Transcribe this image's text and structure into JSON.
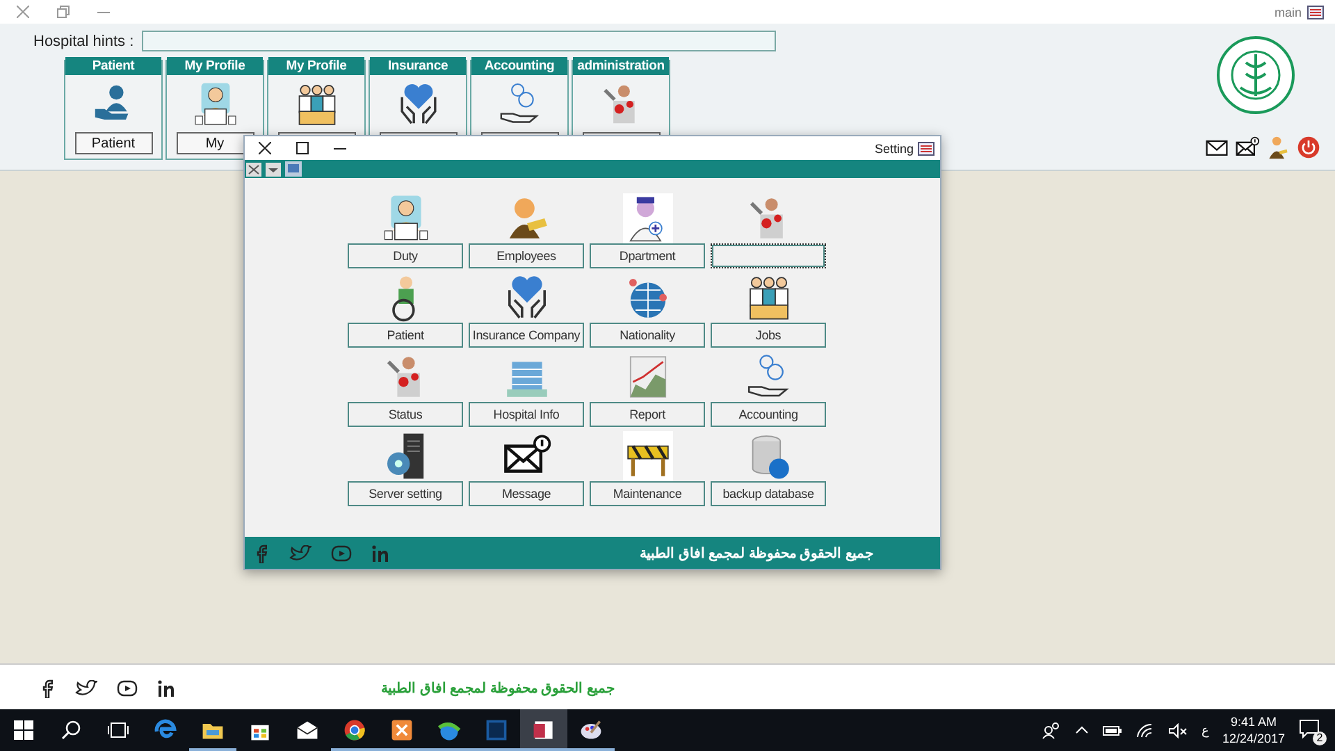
{
  "main_window": {
    "title": "main"
  },
  "hints": {
    "label": "Hospital hints :"
  },
  "modules": [
    {
      "header": "Patient",
      "kind": "patient-hand",
      "button": "Patient"
    },
    {
      "header": "My Profile",
      "kind": "laptop-person",
      "button": "My"
    },
    {
      "header": "My Profile",
      "kind": "team"
    },
    {
      "header": "Insurance",
      "kind": "heart-hands"
    },
    {
      "header": "Accounting",
      "kind": "money-hand"
    },
    {
      "header": "administration",
      "kind": "mechanic"
    }
  ],
  "header_icons": [
    {
      "kind": "mail"
    },
    {
      "kind": "mail-alert"
    },
    {
      "kind": "user-key"
    },
    {
      "kind": "power"
    }
  ],
  "dialog": {
    "title": "Setting",
    "tiles": [
      {
        "label": "Duty",
        "kind": "laptop-person",
        "focused": false
      },
      {
        "label": "Employees",
        "kind": "businessman",
        "focused": false
      },
      {
        "label": "Dpartment",
        "kind": "doctor",
        "focused": false
      },
      {
        "kind": "mechanic",
        "focused": true
      },
      {
        "label": "Patient",
        "kind": "wheelchair",
        "focused": false
      },
      {
        "label": "Insurance Company",
        "kind": "heart-hands",
        "focused": false
      },
      {
        "label": "Nationality",
        "kind": "globe",
        "focused": false
      },
      {
        "label": "Jobs",
        "kind": "team",
        "focused": false
      },
      {
        "label": "Status",
        "kind": "mechanic",
        "focused": false
      },
      {
        "label": "Hospital Info",
        "kind": "building",
        "focused": false
      },
      {
        "label": "Report",
        "kind": "chart",
        "focused": false
      },
      {
        "label": "Accounting",
        "kind": "money-hand",
        "focused": false
      },
      {
        "label": "Server setting",
        "kind": "server",
        "focused": false
      },
      {
        "label": "Message",
        "kind": "mail-alert",
        "focused": false
      },
      {
        "label": "Maintenance",
        "kind": "barrier",
        "focused": false
      },
      {
        "label": "backup database",
        "kind": "database",
        "focused": false
      }
    ],
    "footer_text": "جميع الحقوق محفوظة لمجمع افاق الطبية"
  },
  "footer": {
    "text": "جميع الحقوق محفوظة لمجمع افاق الطبية"
  },
  "taskbar": {
    "apps": [
      {
        "kind": "edge",
        "running": false,
        "active": false
      },
      {
        "kind": "folder",
        "running": true,
        "active": false
      },
      {
        "kind": "store",
        "running": false,
        "active": false
      },
      {
        "kind": "mail",
        "running": false,
        "active": false
      },
      {
        "kind": "chrome",
        "running": true,
        "active": false
      },
      {
        "kind": "xampp",
        "running": true,
        "active": false
      },
      {
        "kind": "globe",
        "running": true,
        "active": false
      },
      {
        "kind": "ps",
        "running": true,
        "active": false
      },
      {
        "kind": "access",
        "running": true,
        "active": true
      },
      {
        "kind": "paint",
        "running": true,
        "active": false
      }
    ],
    "language": "ع",
    "time": "9:41 AM",
    "date": "12/24/2017",
    "notifications": "2"
  }
}
